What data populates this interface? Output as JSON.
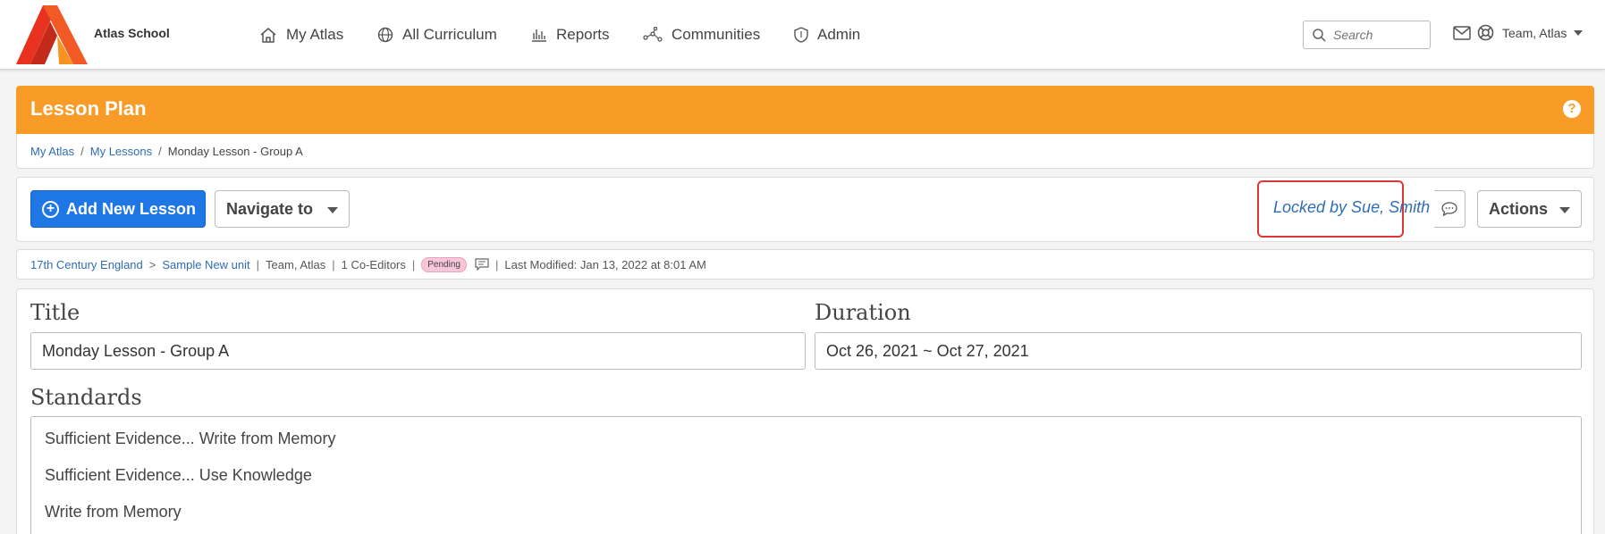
{
  "header": {
    "school_name": "Atlas School",
    "nav": [
      {
        "label": "My Atlas",
        "icon": "home-icon"
      },
      {
        "label": "All Curriculum",
        "icon": "globe-icon"
      },
      {
        "label": "Reports",
        "icon": "bar-chart-icon"
      },
      {
        "label": "Communities",
        "icon": "network-icon"
      },
      {
        "label": "Admin",
        "icon": "shield-icon"
      }
    ],
    "search_placeholder": "Search",
    "user_name": "Team, Atlas"
  },
  "panel": {
    "title": "Lesson Plan",
    "help": "?"
  },
  "breadcrumb": {
    "items": [
      "My Atlas",
      "My Lessons"
    ],
    "current": "Monday Lesson - Group A",
    "separator": "/"
  },
  "toolbar": {
    "add_label": "Add New Lesson",
    "navigate_label": "Navigate to",
    "locked_label": "Locked by Sue, Smith",
    "actions_label": "Actions"
  },
  "meta": {
    "unit_path": [
      "17th Century England",
      "Sample New unit"
    ],
    "path_separator": ">",
    "owner": "Team, Atlas",
    "co_editors": "1 Co-Editors",
    "status": "Pending",
    "last_modified": "Last Modified: Jan 13, 2022 at 8:01 AM"
  },
  "form": {
    "title_label": "Title",
    "title_value": "Monday Lesson - Group A",
    "duration_label": "Duration",
    "duration_value": "Oct 26, 2021 ~ Oct 27, 2021",
    "standards_label": "Standards",
    "standards": [
      "Sufficient Evidence... Write from Memory",
      "Sufficient Evidence... Use Knowledge",
      "Write from Memory"
    ]
  },
  "colors": {
    "accent": "#f99b27",
    "primary": "#1f77e5",
    "link": "#2f6db5",
    "highlight": "#d9383a"
  }
}
